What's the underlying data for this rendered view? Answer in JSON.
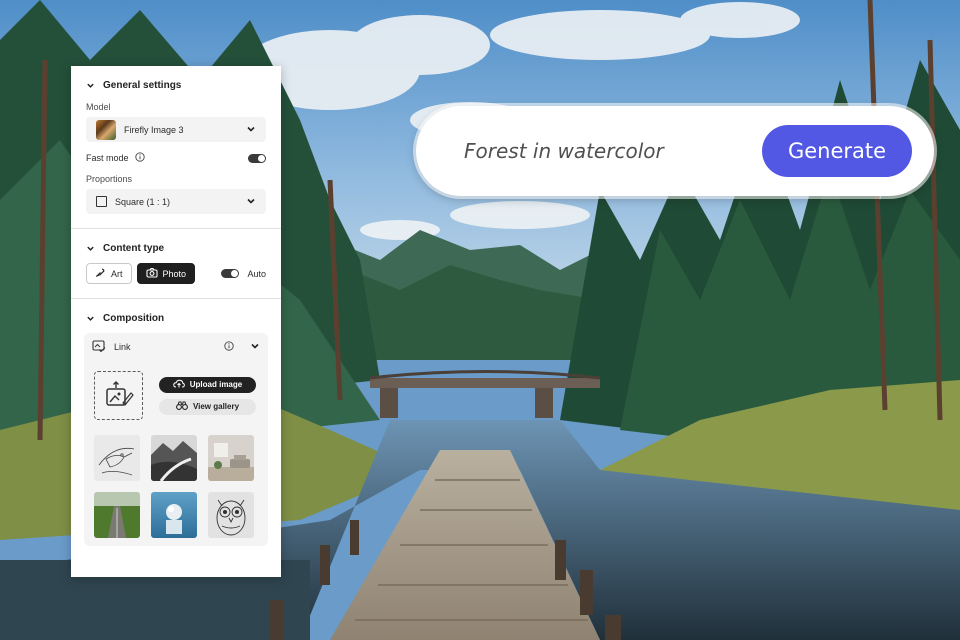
{
  "settings_panel": {
    "general": {
      "title": "General settings",
      "model_label": "Model",
      "model_value": "Firefly Image 3",
      "fast_mode_label": "Fast mode",
      "fast_mode_on": true,
      "proportions_label": "Proportions",
      "proportions_value": "Square (1 : 1)"
    },
    "content_type": {
      "title": "Content type",
      "art_label": "Art",
      "photo_label": "Photo",
      "selected": "Photo",
      "auto_label": "Auto",
      "auto_on": true
    },
    "composition": {
      "title": "Composition",
      "link_label": "Link",
      "upload_label": "Upload image",
      "gallery_label": "View gallery",
      "thumbnails": [
        "bird-sketch",
        "mountain-river",
        "living-room",
        "green-road",
        "sphere-pedestal",
        "owl-sketch"
      ]
    }
  },
  "prompt_bar": {
    "text": "Forest in watercolor",
    "generate_label": "Generate"
  },
  "colors": {
    "accent": "#5258e4",
    "panel_bg": "#ffffff",
    "toggle_on": "#3a3a3a"
  }
}
